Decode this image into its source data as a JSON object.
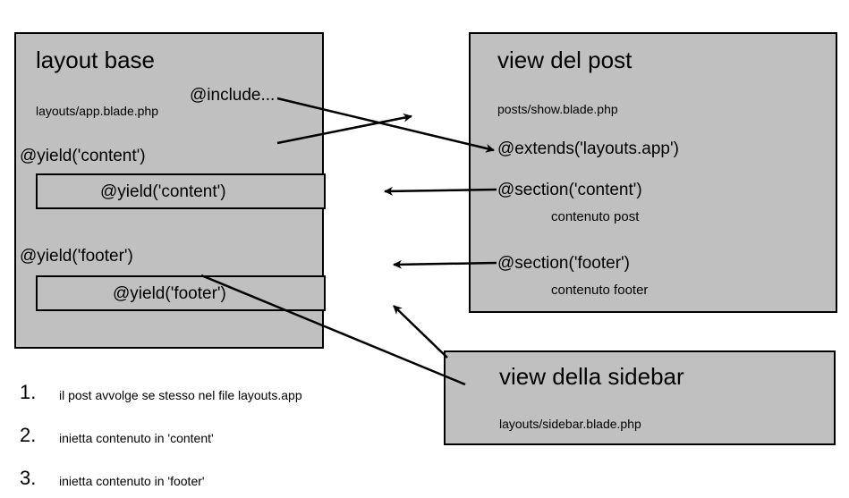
{
  "layout_box": {
    "title": "layout base",
    "path": "layouts/app.blade.php",
    "include": "@include...",
    "yield_content_label": "@yield('content')",
    "yield_content_inner": "@yield('content')",
    "yield_footer_label": "@yield('footer')",
    "yield_footer_inner": "@yield('footer')"
  },
  "post_box": {
    "title": "view del post",
    "path": "posts/show.blade.php",
    "extends": "@extends('layouts.app')",
    "section_content": "@section('content')",
    "content_note": "contenuto post",
    "section_footer": "@section('footer')",
    "footer_note": "contenuto footer"
  },
  "sidebar_box": {
    "title": "view della sidebar",
    "path": "layouts/sidebar.blade.php"
  },
  "list": {
    "n1": "1.",
    "t1": "il post avvolge se stesso nel file layouts.app",
    "n2": "2.",
    "t2": "inietta contenuto in 'content'",
    "n3": "3.",
    "t3": "inietta contenuto in 'footer'"
  }
}
